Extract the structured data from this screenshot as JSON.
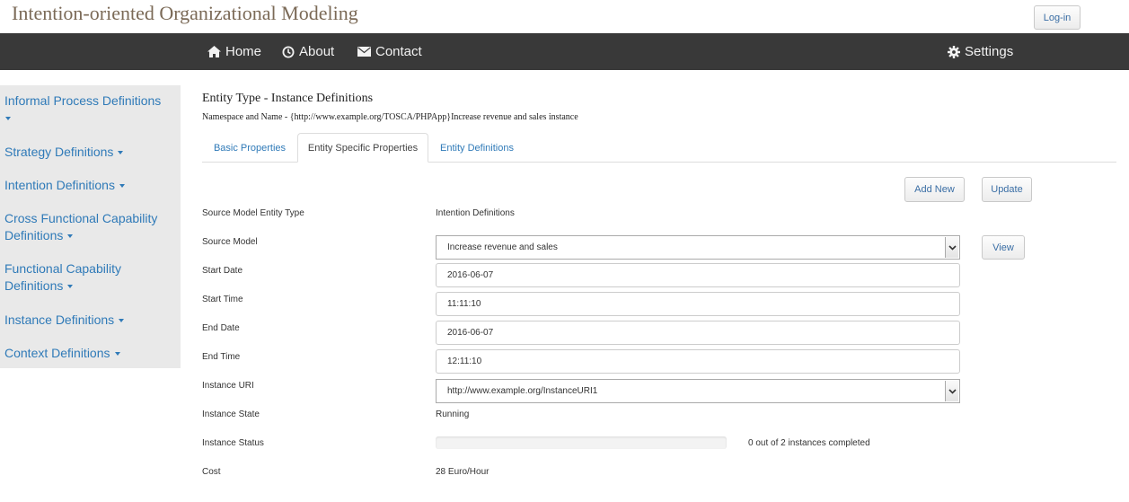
{
  "app": {
    "title": "Intention-oriented Organizational Modeling",
    "login_label": "Log-in"
  },
  "navbar": {
    "background": "#393939",
    "items": [
      {
        "label": "Home",
        "icon": "home-icon"
      },
      {
        "label": "About",
        "icon": "clock-icon"
      },
      {
        "label": "Contact",
        "icon": "envelope-icon"
      }
    ],
    "settings": {
      "label": "Settings",
      "icon": "gear-icon"
    }
  },
  "sidebar": {
    "items": [
      {
        "label": "Informal Process Definitions"
      },
      {
        "label": "Strategy Definitions"
      },
      {
        "label": "Intention Definitions"
      },
      {
        "label": "Cross Functional Capability Definitions"
      },
      {
        "label": "Functional Capability Definitions"
      },
      {
        "label": "Instance Definitions"
      },
      {
        "label": "Context Definitions"
      }
    ]
  },
  "main": {
    "title": "Entity Type - Instance Definitions",
    "namespace_line": "Namespace and Name - {http://www.example.org/TOSCA/PHPApp}Increase revenue and sales instance",
    "tabs": [
      {
        "label": "Basic Properties",
        "active": false
      },
      {
        "label": "Entity Specific Properties",
        "active": true
      },
      {
        "label": "Entity Definitions",
        "active": false
      }
    ],
    "buttons": {
      "add_new": "Add New",
      "update": "Update",
      "view": "View"
    },
    "fields": {
      "source_model_entity_type": {
        "label": "Source Model Entity Type",
        "value": "Intention Definitions"
      },
      "source_model": {
        "label": "Source Model",
        "value": "Increase revenue and sales"
      },
      "start_date": {
        "label": "Start Date",
        "value": "2016-06-07"
      },
      "start_time": {
        "label": "Start Time",
        "value": "11:11:10"
      },
      "end_date": {
        "label": "End Date",
        "value": "2016-06-07"
      },
      "end_time": {
        "label": "End Time",
        "value": "12:11:10"
      },
      "instance_uri": {
        "label": "Instance URI",
        "value": "http://www.example.org/InstanceURI1"
      },
      "instance_state": {
        "label": "Instance State",
        "value": "Running"
      },
      "instance_status": {
        "label": "Instance Status",
        "progress": 0,
        "text": "0 out of 2 instances completed"
      },
      "cost": {
        "label": "Cost",
        "value": "28 Euro/Hour"
      }
    }
  },
  "colors": {
    "link": "#2f7ab8",
    "title": "#7b6a57",
    "sidebar_bg": "#e9e9e9"
  }
}
